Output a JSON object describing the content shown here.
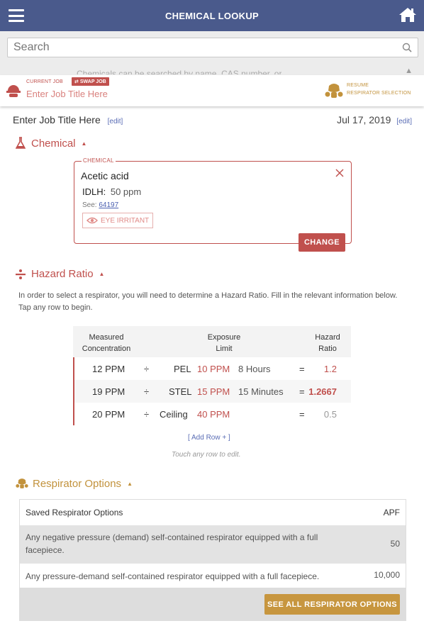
{
  "header": {
    "title": "CHEMICAL LOOKUP",
    "bg_color": "#4a5a8c"
  },
  "search": {
    "placeholder": "Search",
    "hint": "Chemicals can be searched by name, CAS number, or"
  },
  "job_bar": {
    "current_job_label": "CURRENT JOB",
    "swap_label": "SWAP JOB",
    "job_title_placeholder": "Enter Job Title Here",
    "resume_label_1": "RESUME",
    "resume_label_2": "RESPIRATOR SELECTION"
  },
  "job": {
    "title": "Enter Job Title Here",
    "edit_label": "[edit]",
    "date": "Jul 17, 2019",
    "date_edit_label": "[edit]"
  },
  "chemical_section": {
    "heading": "Chemical",
    "card_label": "CHEMICAL",
    "name": "Acetic acid",
    "idlh_label": "IDLH:",
    "idlh_value": "50 ppm",
    "see_label": "See:",
    "see_link": "64197",
    "badge": "EYE IRRITANT",
    "change_label": "CHANGE"
  },
  "hazard_section": {
    "heading": "Hazard Ratio",
    "description": "In order to select a respirator, you will need to determine a Hazard Ratio. Fill in the relevant information below. Tap any row to begin.",
    "columns": {
      "measured_1": "Measured",
      "measured_2": "Concentration",
      "exposure_1": "Exposure",
      "exposure_2": "Limit",
      "hazard_1": "Hazard",
      "hazard_2": "Ratio"
    },
    "rows": [
      {
        "measured": "12 PPM",
        "divider": "÷",
        "type": "PEL",
        "limit": "10 PPM",
        "duration": "8 Hours",
        "equals": "=",
        "ratio": "1.2"
      },
      {
        "measured": "19 PPM",
        "divider": "÷",
        "type": "STEL",
        "limit": "15 PPM",
        "duration": "15 Minutes",
        "equals": "=",
        "ratio": "1.2667"
      },
      {
        "measured": "20 PPM",
        "divider": "÷",
        "type": "Ceiling",
        "limit": "40 PPM",
        "duration": "",
        "equals": "=",
        "ratio": "0.5"
      }
    ],
    "add_row_label": "[ Add Row + ]",
    "touch_hint": "Touch any row to edit."
  },
  "respirator_section": {
    "heading": "Respirator Options",
    "table_header": "Saved Respirator Options",
    "apf_header": "APF",
    "rows": [
      {
        "description": "Any negative pressure (demand) self-contained respirator equipped with a full facepiece.",
        "apf": "50"
      },
      {
        "description": "Any pressure-demand self-contained respirator equipped with a full facepiece.",
        "apf": "10,000"
      }
    ],
    "see_all_label": "SEE ALL RESPIRATOR OPTIONS"
  },
  "colors": {
    "accent_red": "#c0504d",
    "accent_gold": "#c7963f",
    "link_blue": "#5a6db5"
  }
}
